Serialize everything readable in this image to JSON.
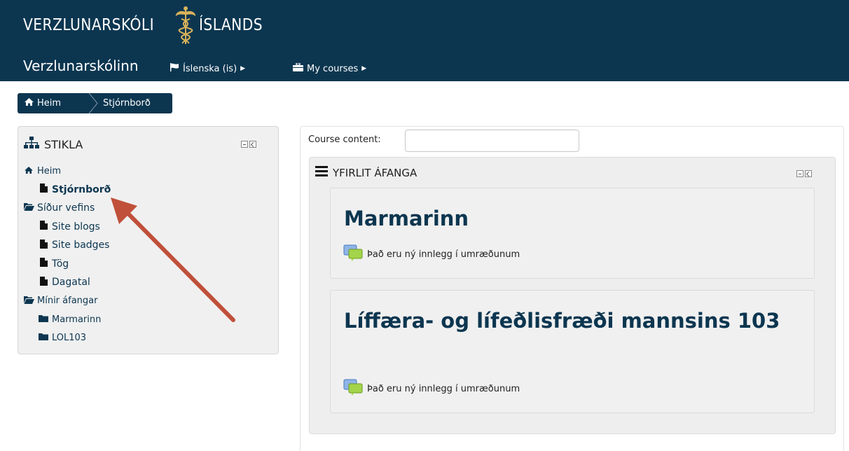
{
  "header": {
    "logo_left": "VERZLUNARSKÓLI",
    "logo_right": "ÍSLANDS",
    "brand": "Verzlunarskólinn",
    "nav": [
      {
        "label": "Íslenska (is)",
        "icon": "flag-icon"
      },
      {
        "label": "My courses",
        "icon": "briefcase-icon"
      }
    ]
  },
  "breadcrumb": {
    "home": "Heim",
    "current": "Stjórnborð"
  },
  "navigation_block": {
    "title": "STIKLA",
    "items": [
      {
        "label": "Heim",
        "icon": "home-icon",
        "level": 1
      },
      {
        "label": "Stjórnborð",
        "icon": "page-icon",
        "level": 2,
        "bold": true
      },
      {
        "label": "Síður vefins",
        "icon": "folder-open-icon",
        "level": 1
      },
      {
        "label": "Site blogs",
        "icon": "page-icon",
        "level": 2
      },
      {
        "label": "Site badges",
        "icon": "page-icon",
        "level": 2
      },
      {
        "label": "Tög",
        "icon": "page-icon",
        "level": 2
      },
      {
        "label": "Dagatal",
        "icon": "page-icon",
        "level": 2
      },
      {
        "label": "Mínir áfangar",
        "icon": "folder-open-icon",
        "level": 1
      },
      {
        "label": "Marmarinn",
        "icon": "folder-icon",
        "level": 2
      },
      {
        "label": "LOL103",
        "icon": "folder-icon",
        "level": 2
      }
    ]
  },
  "main": {
    "course_content_label": "Course content:",
    "course_content_value": "",
    "overview_title": "YFIRLIT ÁFANGA",
    "courses": [
      {
        "title": "Marmarinn",
        "notice": "Það eru ný innlegg í umræðunum"
      },
      {
        "title": "Líffæra- og lífeðlisfræði mannsins 103",
        "notice": "Það eru ný innlegg í umræðunum"
      }
    ]
  },
  "colors": {
    "header_bg": "#0c3650",
    "link": "#0c3650",
    "arrow": "#c0503a"
  }
}
